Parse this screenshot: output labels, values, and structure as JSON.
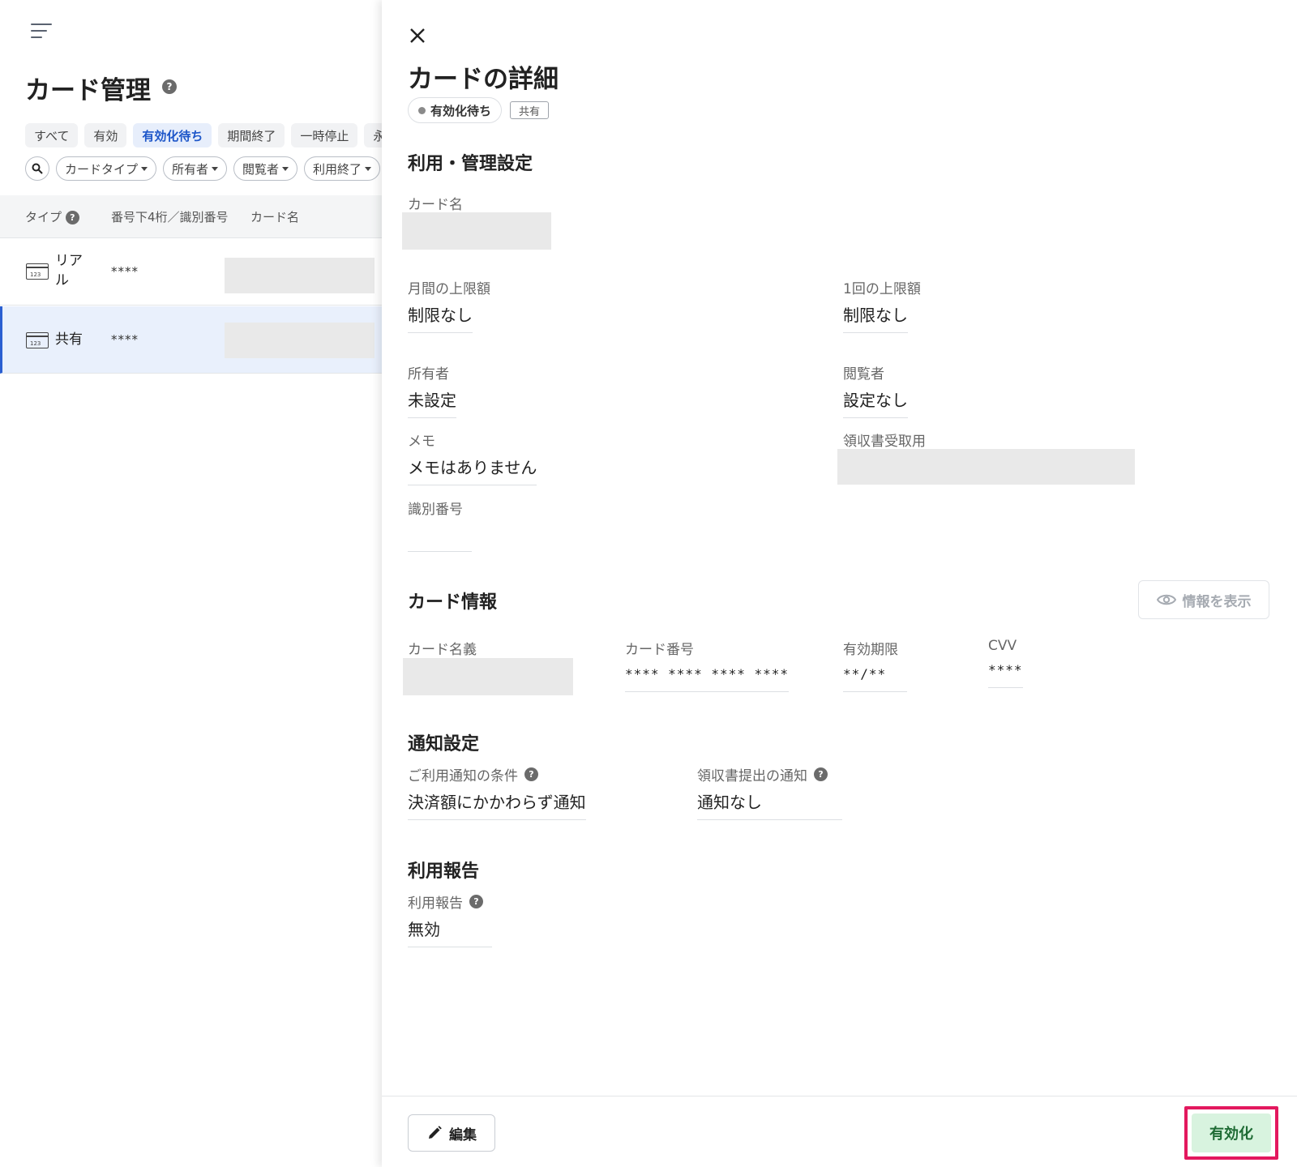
{
  "list_page": {
    "title": "カード管理",
    "help_glyph": "?",
    "tabs": [
      {
        "label": "すべて",
        "active": false
      },
      {
        "label": "有効",
        "active": false
      },
      {
        "label": "有効化待ち",
        "active": true
      },
      {
        "label": "期間終了",
        "active": false
      },
      {
        "label": "一時停止",
        "active": false
      },
      {
        "label": "永",
        "active": false
      }
    ],
    "filters": [
      "カードタイプ",
      "所有者",
      "閲覧者",
      "利用終了"
    ],
    "columns": {
      "type": "タイプ",
      "last4": "番号下4桁／識別番号",
      "card_name": "カード名"
    },
    "rows": [
      {
        "type": "リアル",
        "number": "****",
        "selected": false
      },
      {
        "type": "共有",
        "number": "****",
        "selected": true
      }
    ]
  },
  "drawer": {
    "title": "カードの詳細",
    "status": "有効化待ち",
    "tag": "共有",
    "usage_section": {
      "heading": "利用・管理設定",
      "card_name_label": "カード名",
      "monthly_limit_label": "月間の上限額",
      "monthly_limit_value": "制限なし",
      "per_tx_limit_label": "1回の上限額",
      "per_tx_limit_value": "制限なし",
      "owner_label": "所有者",
      "owner_value": "未設定",
      "viewer_label": "閲覧者",
      "viewer_value": "設定なし",
      "memo_label": "メモ",
      "memo_value": "メモはありません",
      "receipt_label": "領収書受取用",
      "id_label": "識別番号",
      "id_value": ""
    },
    "card_info": {
      "heading": "カード情報",
      "show_button": "情報を表示",
      "holder_label": "カード名義",
      "number_label": "カード番号",
      "number_value": "**** **** **** ****",
      "expiry_label": "有効期限",
      "expiry_value": "**/**",
      "cvv_label": "CVV",
      "cvv_value": "****"
    },
    "notification": {
      "heading": "通知設定",
      "condition_label": "ご利用通知の条件",
      "condition_value": "決済額にかかわらず通知",
      "receipt_notice_label": "領収書提出の通知",
      "receipt_notice_value": "通知なし"
    },
    "usage_report": {
      "heading": "利用報告",
      "label": "利用報告",
      "value": "無効"
    },
    "footer": {
      "edit_button": "編集",
      "activate_button": "有効化"
    }
  },
  "colors": {
    "accent": "#1d56c9",
    "selected_row": "#e9f0fc",
    "activate_bg": "#d8f3df",
    "highlight": "#e3185e"
  }
}
